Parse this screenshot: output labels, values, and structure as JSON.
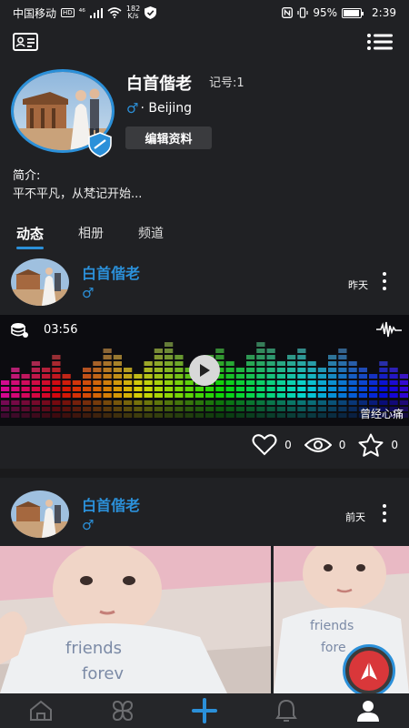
{
  "status_bar": {
    "carrier": "中国移动",
    "hd": "HD",
    "signal_label": "⁴⁶",
    "speed_value": "182",
    "speed_unit": "K/s",
    "battery_pct": "95%",
    "battery_fill": 0.95,
    "time": "2:39"
  },
  "profile": {
    "name": "白首偕老",
    "id_label": "记号:1",
    "gender_symbol": "♂",
    "location": "· Beijing",
    "edit_label": "编辑资料",
    "intro_label": "简介:",
    "intro_text": "平不平凡，从梵记开始..."
  },
  "tabs": [
    {
      "label": "动态",
      "active": true
    },
    {
      "label": "相册",
      "active": false
    },
    {
      "label": "频道",
      "active": false
    }
  ],
  "posts": [
    {
      "author": "白首偕老",
      "gender_symbol": "♂",
      "time": "昨天",
      "audio": {
        "duration": "03:56",
        "title": "曾经心痛"
      },
      "likes": "0",
      "views": "0",
      "favorites": "0"
    },
    {
      "author": "白首偕老",
      "gender_symbol": "♂",
      "time": "前天"
    }
  ],
  "colors": {
    "accent": "#2b90d9",
    "background": "#202124",
    "fab": "#d9373a"
  },
  "icons": {
    "topbar_left": "id-card-icon",
    "topbar_right": "list-menu-icon",
    "nav": [
      "home-icon",
      "clover-icon",
      "plus-icon",
      "bell-icon",
      "user-icon"
    ]
  }
}
